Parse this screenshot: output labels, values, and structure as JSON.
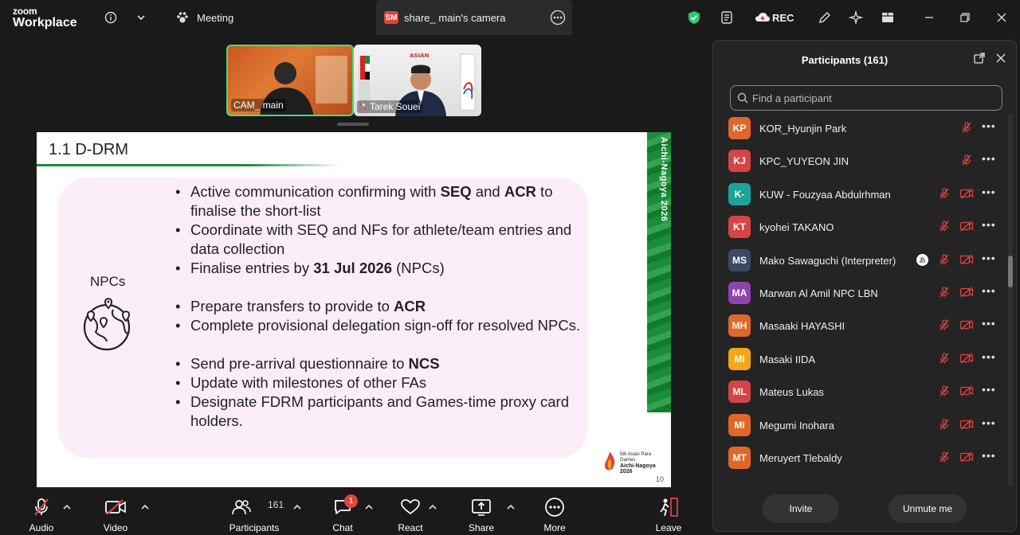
{
  "app": {
    "logo_top": "zoom",
    "logo_bottom": "Workplace",
    "meeting_tab": "Meeting",
    "share_tab_badge": "SM",
    "share_tab_label": "share_ main's camera",
    "rec_label": "REC"
  },
  "videos": [
    {
      "name": "CAM_ main"
    },
    {
      "name": "Tarek Souei"
    }
  ],
  "slide": {
    "title": "1.1 D-DRM",
    "section_label": "NPCs",
    "strip_text": "Aichi-Nagoya 2026",
    "games_logo_line1": "5th Asian Para Games",
    "games_logo_line2": "Aichi-Nagoya",
    "games_logo_line3": "2026",
    "page_number": "10",
    "b1_a": "Active communication confirming with ",
    "b1_b": "SEQ",
    "b1_c": " and ",
    "b1_d": "ACR",
    "b1_e": " to finalise the short-list",
    "b2": "Coordinate with SEQ and NFs for athlete/team entries and data collection",
    "b3_a": "Finalise entries by ",
    "b3_b": "31 Jul 2026",
    "b3_c": " (NPCs)",
    "b4_a": "Prepare transfers to provide to ",
    "b4_b": "ACR",
    "b5": "Complete provisional delegation sign-off for resolved NPCs.",
    "b6_a": "Send pre-arrival questionnaire to ",
    "b6_b": "NCS",
    "b7": "Update with milestones of other FAs",
    "b8": "Designate FDRM participants and Games-time proxy card holders."
  },
  "toolbar": {
    "audio": "Audio",
    "video": "Video",
    "participants": "Participants",
    "participants_count": "161",
    "chat": "Chat",
    "chat_badge": "1",
    "react": "React",
    "share": "Share",
    "more": "More",
    "leave": "Leave"
  },
  "participants_panel": {
    "title": "Participants (161)",
    "search_placeholder": "Find a participant",
    "invite": "Invite",
    "unmute_me": "Unmute me",
    "rows": [
      {
        "initials": "KP",
        "name": "KOR_Hyunjin Park",
        "color": "#e0662a"
      },
      {
        "initials": "KJ",
        "name": "KPC_YUYEON JIN",
        "color": "#d64545"
      },
      {
        "initials": "K-",
        "name": "KUW - Fouzyaa Abdulrhman",
        "color": "#1ba39c"
      },
      {
        "initials": "KT",
        "name": "kyohei TAKANO",
        "color": "#d64545"
      },
      {
        "initials": "MS",
        "name": "Mako Sawaguchi (Interpreter)",
        "color": "#3b4a63",
        "interpreter_badge": "あ"
      },
      {
        "initials": "MA",
        "name": "Marwan Al Amil NPC LBN",
        "color": "#8e44ad"
      },
      {
        "initials": "MH",
        "name": "Masaaki HAYASHI",
        "color": "#e0662a"
      },
      {
        "initials": "MI",
        "name": "Masaki IIDA",
        "color": "#f0a818"
      },
      {
        "initials": "ML",
        "name": "Mateus Lukas",
        "color": "#d64545"
      },
      {
        "initials": "MI",
        "name": "Megumi Inohara",
        "color": "#e0662a"
      },
      {
        "initials": "MT",
        "name": "Meruyert Tlebaldy",
        "color": "#e0662a"
      }
    ]
  }
}
